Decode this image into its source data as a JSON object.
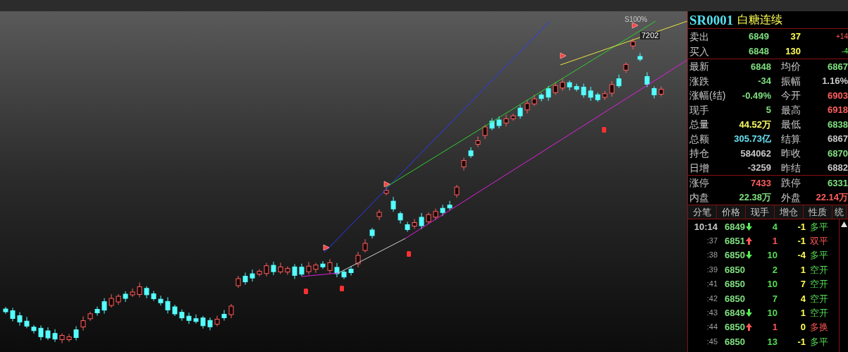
{
  "chart": {
    "labels": [
      {
        "kind": "signal",
        "text": "S100%"
      },
      {
        "kind": "price",
        "text": "7202"
      }
    ]
  },
  "quote": {
    "code": "SR0001",
    "name": "白糖连续",
    "book": [
      {
        "label": "卖出",
        "price": "6849",
        "volume": "37",
        "change": {
          "text": "+14",
          "color": "#ff5555"
        }
      },
      {
        "label": "买入",
        "price": "6848",
        "volume": "130",
        "change": {
          "text": "-4",
          "color": "#55ff55"
        }
      }
    ],
    "sections": [
      [
        [
          {
            "label": "最新",
            "value": "6848",
            "color": "#7fe07f"
          },
          {
            "label": "均价",
            "value": "6867",
            "color": "#7fe07f"
          }
        ],
        [
          {
            "label": "涨跌",
            "value": "-34",
            "color": "#7fe07f"
          },
          {
            "label": "振幅",
            "value": "1.16%",
            "color": "#c8c8c8"
          }
        ],
        [
          {
            "label": "涨幅(结)",
            "value": "-0.49%",
            "color": "#7fe07f"
          },
          {
            "label": "今开",
            "value": "6903",
            "color": "#ff5f5f"
          }
        ],
        [
          {
            "label": "现手",
            "value": "5",
            "color": "#7fe07f"
          },
          {
            "label": "最高",
            "value": "6918",
            "color": "#ff5f5f"
          }
        ],
        [
          {
            "label": "总量",
            "value": "44.52万",
            "color": "#ffff66"
          },
          {
            "label": "最低",
            "value": "6838",
            "color": "#7fe07f"
          }
        ],
        [
          {
            "label": "总额",
            "value": "305.73亿",
            "color": "#66e0f0"
          },
          {
            "label": "结算",
            "value": "6867",
            "color": "#c8c8c8"
          }
        ],
        [
          {
            "label": "持仓",
            "value": "584062",
            "color": "#c8c8c8"
          },
          {
            "label": "昨收",
            "value": "6870",
            "color": "#7fe07f"
          }
        ],
        [
          {
            "label": "日增",
            "value": "-3259",
            "color": "#c8c8c8"
          },
          {
            "label": "昨结",
            "value": "6882",
            "color": "#c8c8c8"
          }
        ]
      ],
      [
        [
          {
            "label": "涨停",
            "value": "7433",
            "color": "#ff5f5f"
          },
          {
            "label": "跌停",
            "value": "6331",
            "color": "#7fe07f"
          }
        ],
        [
          {
            "label": "内盘",
            "value": "22.38万",
            "color": "#7fe07f"
          },
          {
            "label": "外盘",
            "value": "22.14万",
            "color": "#ff5f5f"
          }
        ]
      ]
    ]
  },
  "ticks": {
    "columns": [
      "分笔",
      "价格",
      "现手",
      "增仓",
      "性质",
      "统"
    ],
    "rows": [
      {
        "time": "10:14",
        "price": "6849",
        "kind": "down",
        "volume": "4",
        "oi_change": "-1",
        "nature": "多平",
        "color": "#55dd55"
      },
      {
        "time": ":37",
        "price": "6851",
        "kind": "up",
        "volume": "1",
        "oi_change": "-1",
        "nature": "双平",
        "color": "#ff5555"
      },
      {
        "time": ":38",
        "price": "6850",
        "kind": "down",
        "volume": "10",
        "oi_change": "-4",
        "nature": "多平",
        "color": "#55dd55"
      },
      {
        "time": ":39",
        "price": "6850",
        "kind": "flat",
        "volume": "2",
        "oi_change": "1",
        "nature": "空开",
        "color": "#55dd55"
      },
      {
        "time": ":41",
        "price": "6850",
        "kind": "flat",
        "volume": "10",
        "oi_change": "7",
        "nature": "空开",
        "color": "#55dd55"
      },
      {
        "time": ":42",
        "price": "6850",
        "kind": "flat",
        "volume": "7",
        "oi_change": "4",
        "nature": "空开",
        "color": "#55dd55"
      },
      {
        "time": ":43",
        "price": "6849",
        "kind": "down",
        "volume": "10",
        "oi_change": "1",
        "nature": "空开",
        "color": "#55dd55"
      },
      {
        "time": ":44",
        "price": "6850",
        "kind": "up",
        "volume": "1",
        "oi_change": "0",
        "nature": "多换",
        "color": "#ff5555"
      },
      {
        "time": ":45",
        "price": "6850",
        "kind": "flat",
        "volume": "13",
        "oi_change": "-1",
        "nature": "多平",
        "color": "#55dd55"
      }
    ]
  }
}
